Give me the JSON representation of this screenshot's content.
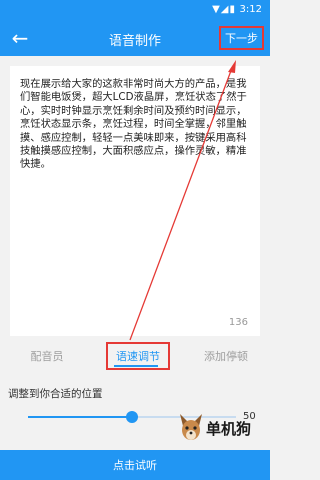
{
  "status_bar": {
    "icons": "▼◢▮",
    "time": "3:12"
  },
  "app_bar": {
    "back_icon": "←",
    "title": "语音制作",
    "next_label": "下一步"
  },
  "editor": {
    "text": "现在展示给大家的这款非常时尚大方的产品，是我们智能电饭煲，超大LCD液晶屏，烹饪状态了然于心，实时时钟显示烹饪剩余时间及预约时间显示，烹饪状态显示条，烹饪过程，时间全掌握，邻里触摸、感应控制，轻轻一点美味即来，按键采用高科技触摸感应控制，大面积感应点，操作灵敏，精准快捷。",
    "char_count": "136"
  },
  "tabs": [
    {
      "label": "配音员"
    },
    {
      "label": "语速调节"
    },
    {
      "label": "添加停顿"
    }
  ],
  "speed": {
    "label": "调整到你合适的位置",
    "value": "50",
    "fraction": 0.5
  },
  "footer": {
    "try_label": "点击试听"
  },
  "watermark": {
    "text": "单机狗"
  },
  "colors": {
    "primary": "#2196f3",
    "highlight": "#e53935"
  }
}
